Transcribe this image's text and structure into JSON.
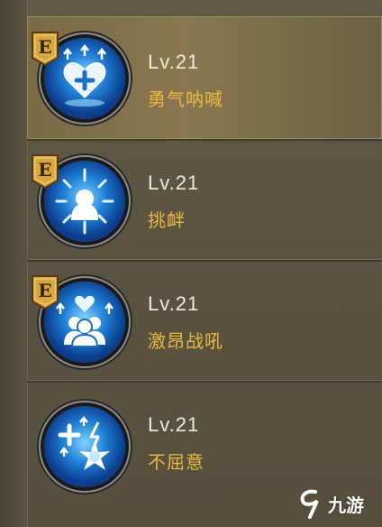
{
  "skills": [
    {
      "grade": "E",
      "level": "Lv.21",
      "name": "勇气呐喊",
      "icon": "heart-plus-icon",
      "selected": true
    },
    {
      "grade": "E",
      "level": "Lv.21",
      "name": "挑衅",
      "icon": "taunt-burst-icon",
      "selected": false
    },
    {
      "grade": "E",
      "level": "Lv.21",
      "name": "激昂战吼",
      "icon": "group-heart-icon",
      "selected": false
    },
    {
      "grade": "",
      "level": "Lv.21",
      "name": "不屈意",
      "icon": "star-burst-icon",
      "selected": false
    }
  ],
  "watermark": {
    "text": "九游"
  },
  "colors": {
    "name": "#e9b93f",
    "level": "#f0ead8",
    "badge": "#d8a840",
    "icon_blue": "#1f7fd6"
  }
}
